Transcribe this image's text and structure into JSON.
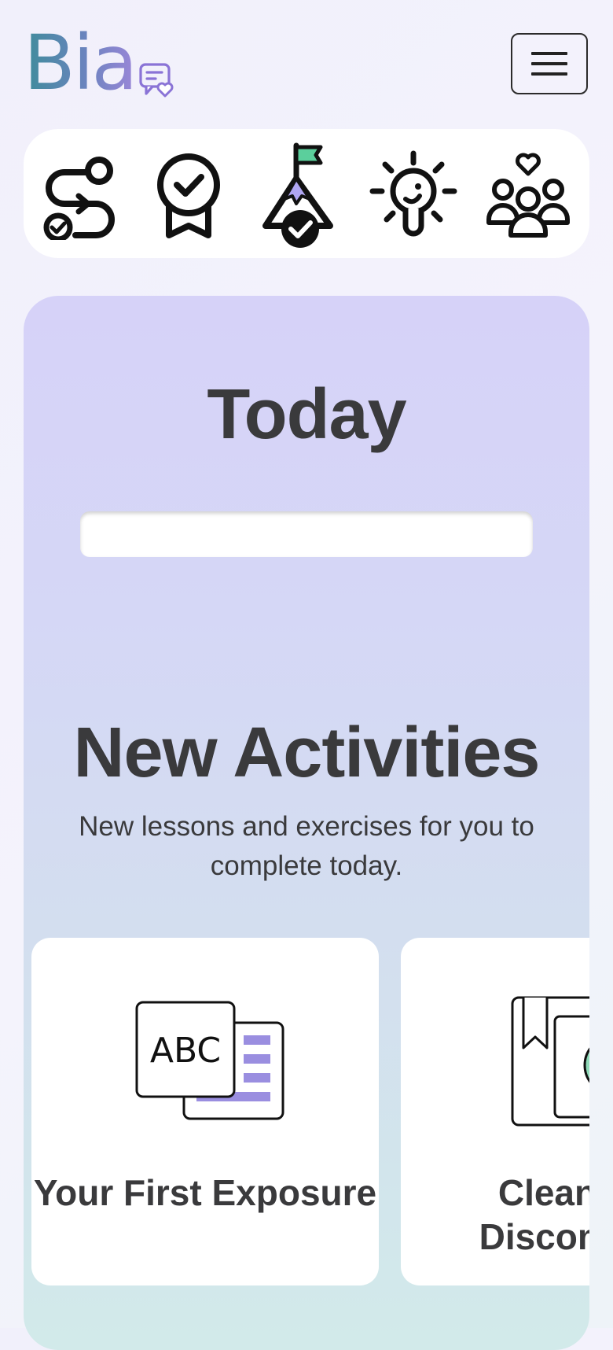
{
  "brand": {
    "name": "Bia",
    "chat_icon": "chat-heart-icon"
  },
  "menu": {
    "icon": "hamburger-menu-icon"
  },
  "nav_icons": [
    {
      "name": "journey-path-icon"
    },
    {
      "name": "achievement-badge-icon"
    },
    {
      "name": "goal-summit-icon"
    },
    {
      "name": "ideas-lightbulb-icon"
    },
    {
      "name": "community-icon"
    }
  ],
  "today": {
    "title": "Today"
  },
  "new_activities": {
    "title": "New Activities",
    "subtitle": "New lessons and exercises for you to complete today."
  },
  "activities": [
    {
      "title": "Your First Exposure",
      "icon": "abc-flashcard-icon"
    },
    {
      "title": "Clean Vs Discomfort",
      "icon": "book-image-icon"
    }
  ],
  "colors": {
    "accent_purple": "#9a8ee0",
    "accent_green": "#4fcf9a",
    "text": "#3a3a3c",
    "logo_teal": "#3f8c9b",
    "logo_violet": "#9a86d8"
  }
}
